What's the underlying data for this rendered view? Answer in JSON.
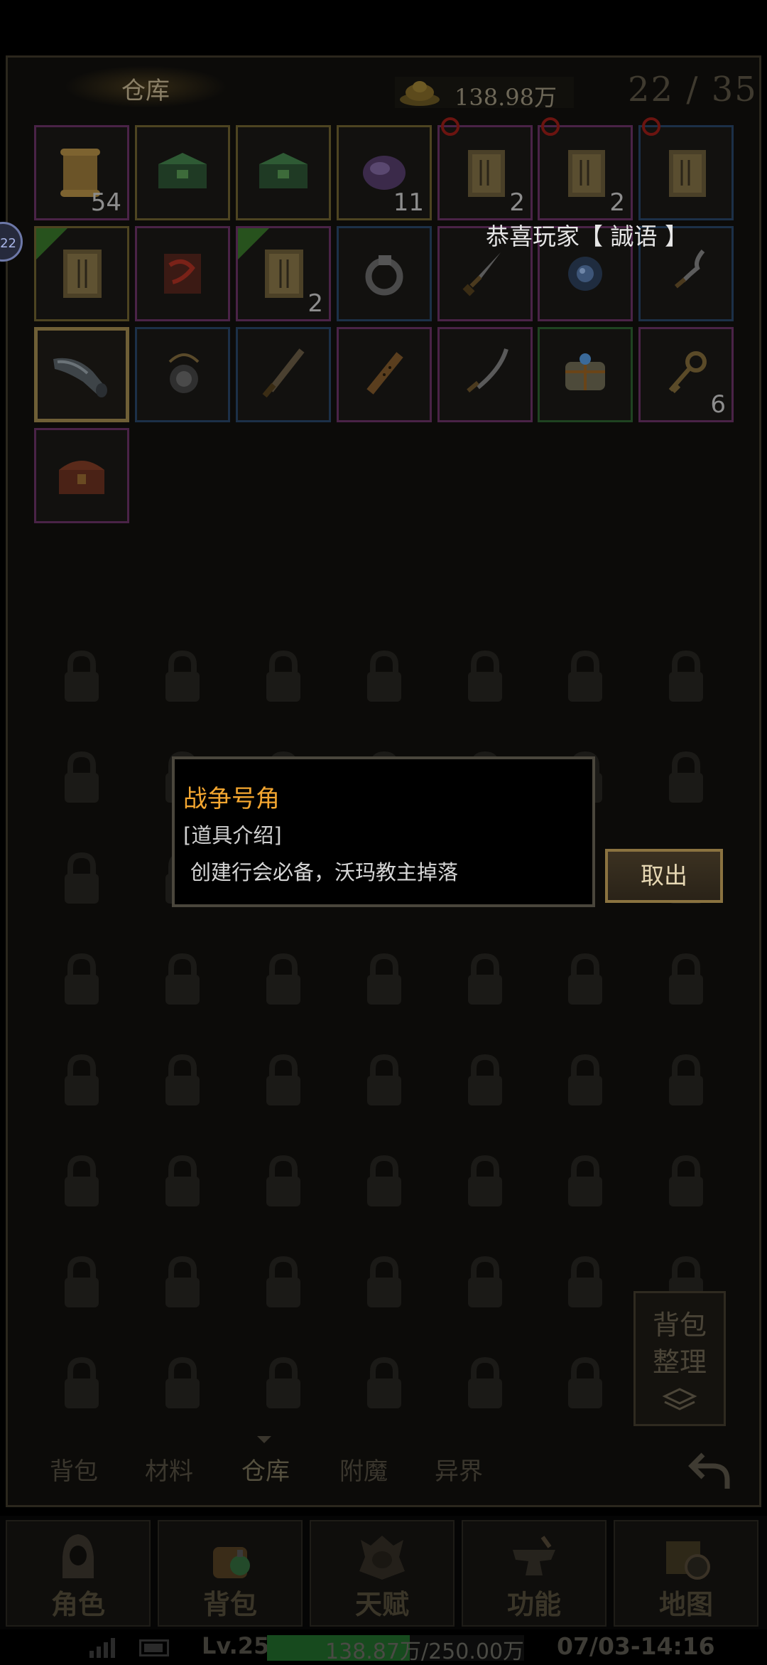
{
  "header": {
    "title": "仓库",
    "gold": "138.98万",
    "capacity": "22 / 35"
  },
  "notice": "恭喜玩家【 誠语 】",
  "side_badge": "22",
  "inventory": {
    "slots": [
      {
        "item": "scroll",
        "count": "54",
        "rarity": "purple"
      },
      {
        "item": "green-chest",
        "count": "",
        "rarity": "yellow"
      },
      {
        "item": "green-chest",
        "count": "",
        "rarity": "yellow"
      },
      {
        "item": "purple-gem",
        "count": "11",
        "rarity": "yellow"
      },
      {
        "item": "book",
        "count": "2",
        "rarity": "purple",
        "forbid": true
      },
      {
        "item": "book",
        "count": "2",
        "rarity": "purple",
        "forbid": true
      },
      {
        "item": "book",
        "count": "",
        "rarity": "blue",
        "forbid": true
      },
      {
        "item": "skill-book",
        "count": "",
        "rarity": "yellow",
        "tag": "可用"
      },
      {
        "item": "red-scroll",
        "count": "",
        "rarity": "purple"
      },
      {
        "item": "skill-book",
        "count": "2",
        "rarity": "purple",
        "tag": "可用"
      },
      {
        "item": "ring",
        "count": "",
        "rarity": "blue"
      },
      {
        "item": "dagger",
        "count": "",
        "rarity": "purple"
      },
      {
        "item": "orb",
        "count": "",
        "rarity": "purple"
      },
      {
        "item": "wavy-dagger",
        "count": "",
        "rarity": "blue"
      },
      {
        "item": "war-horn",
        "count": "",
        "rarity": "yellow",
        "selected": true
      },
      {
        "item": "amulet",
        "count": "",
        "rarity": "blue"
      },
      {
        "item": "sword",
        "count": "",
        "rarity": "blue"
      },
      {
        "item": "flute",
        "count": "",
        "rarity": "purple"
      },
      {
        "item": "saber",
        "count": "",
        "rarity": "purple"
      },
      {
        "item": "bundle",
        "count": "",
        "rarity": "green"
      },
      {
        "item": "key",
        "count": "6",
        "rarity": "purple"
      },
      {
        "item": "treasure-chest",
        "count": "",
        "rarity": "purple"
      }
    ]
  },
  "tooltip": {
    "name": "战争号角",
    "section": "[道具介绍]",
    "description": "创建行会必备，沃玛教主掉落"
  },
  "buttons": {
    "take_out": "取出",
    "sort": "背包整理"
  },
  "tabs": [
    "背包",
    "材料",
    "仓库",
    "附魔",
    "异界"
  ],
  "active_tab": "仓库",
  "nav": [
    {
      "label": "角色",
      "icon": "hooded-figure-icon"
    },
    {
      "label": "背包",
      "icon": "potion-bag-icon"
    },
    {
      "label": "天赋",
      "icon": "skull-crest-icon"
    },
    {
      "label": "功能",
      "icon": "anvil-icon"
    },
    {
      "label": "地图",
      "icon": "map-compass-icon"
    }
  ],
  "status": {
    "level": "Lv.25",
    "exp": "138.87万/250.00万",
    "exp_fraction": 0.555,
    "time": "07/03-14:16"
  },
  "colors": {
    "accent_gold": "#f3a630",
    "purple_border": "#4a2347",
    "yellow_border": "#4d4421",
    "blue_border": "#1c3048",
    "green_border": "#1f4321",
    "exp_green": "#174a1e"
  }
}
